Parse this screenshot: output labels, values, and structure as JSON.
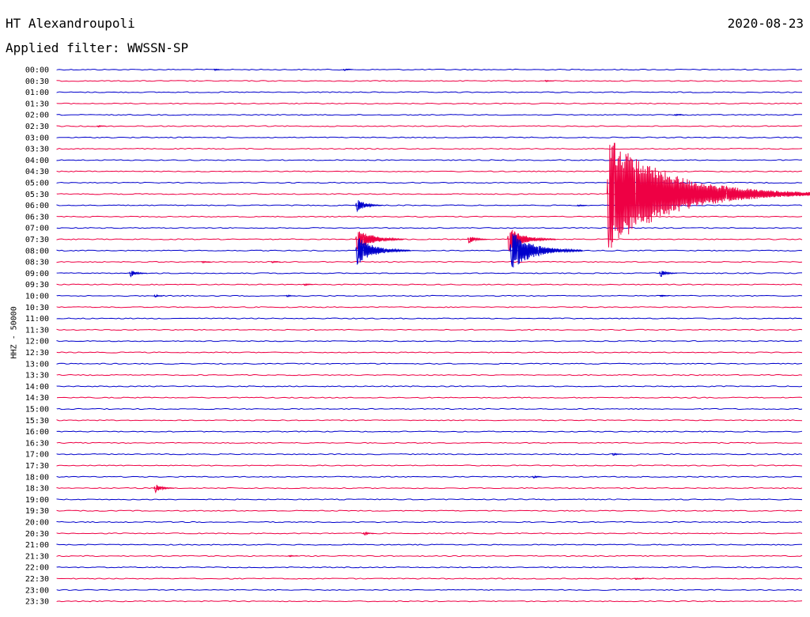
{
  "header": {
    "station": "HT Alexandroupoli",
    "date": "2020-08-23",
    "filter": "Applied filter: WWSSN-SP"
  },
  "chart_data": {
    "type": "line",
    "title": "HT Alexandroupoli",
    "ylabel": "HHZ - 50000",
    "colors": [
      "#0000cc",
      "#ee0044"
    ],
    "time_labels": [
      "00:00",
      "00:30",
      "01:00",
      "01:30",
      "02:00",
      "02:30",
      "03:00",
      "03:30",
      "04:00",
      "04:30",
      "05:00",
      "05:30",
      "06:00",
      "06:30",
      "07:00",
      "07:30",
      "08:00",
      "08:30",
      "09:00",
      "09:30",
      "10:00",
      "10:30",
      "11:00",
      "11:30",
      "12:00",
      "12:30",
      "13:00",
      "13:30",
      "14:00",
      "14:30",
      "15:00",
      "15:30",
      "16:00",
      "16:30",
      "17:00",
      "17:30",
      "18:00",
      "18:30",
      "19:00",
      "19:30",
      "20:00",
      "20:30",
      "21:00",
      "21:30",
      "22:00",
      "22:30",
      "23:00",
      "23:30"
    ],
    "x_unit": "minutes within 30-min line",
    "xlim": [
      0,
      30
    ],
    "events": [
      {
        "row": 0,
        "x": 6.3,
        "amp": 0.3
      },
      {
        "row": 0,
        "x": 11.5,
        "amp": 0.3
      },
      {
        "row": 1,
        "x": 19.6,
        "amp": 0.25
      },
      {
        "row": 4,
        "x": 24.8,
        "amp": 0.2
      },
      {
        "row": 5,
        "x": 1.6,
        "amp": 0.25
      },
      {
        "row": 11,
        "x": 22.1,
        "amp": 9.5
      },
      {
        "row": 12,
        "x": 12.0,
        "amp": 1.2
      },
      {
        "row": 12,
        "x": 20.9,
        "amp": 0.3
      },
      {
        "row": 15,
        "x": 12.0,
        "amp": 2.2
      },
      {
        "row": 15,
        "x": 16.5,
        "amp": 0.9
      },
      {
        "row": 15,
        "x": 18.1,
        "amp": 2.2
      },
      {
        "row": 16,
        "x": 12.0,
        "amp": 2.5
      },
      {
        "row": 16,
        "x": 18.2,
        "amp": 3.3
      },
      {
        "row": 17,
        "x": 5.8,
        "amp": 0.3
      },
      {
        "row": 17,
        "x": 8.6,
        "amp": 0.3
      },
      {
        "row": 18,
        "x": 2.9,
        "amp": 0.8
      },
      {
        "row": 18,
        "x": 24.2,
        "amp": 0.8
      },
      {
        "row": 19,
        "x": 9.9,
        "amp": 0.3
      },
      {
        "row": 20,
        "x": 3.9,
        "amp": 0.4
      },
      {
        "row": 20,
        "x": 9.2,
        "amp": 0.3
      },
      {
        "row": 20,
        "x": 24.2,
        "amp": 0.3
      },
      {
        "row": 34,
        "x": 22.3,
        "amp": 0.4
      },
      {
        "row": 36,
        "x": 19.1,
        "amp": 0.4
      },
      {
        "row": 37,
        "x": 3.9,
        "amp": 0.9
      },
      {
        "row": 41,
        "x": 12.3,
        "amp": 0.5
      },
      {
        "row": 43,
        "x": 9.3,
        "amp": 0.2
      },
      {
        "row": 45,
        "x": 23.2,
        "amp": 0.25
      }
    ]
  }
}
